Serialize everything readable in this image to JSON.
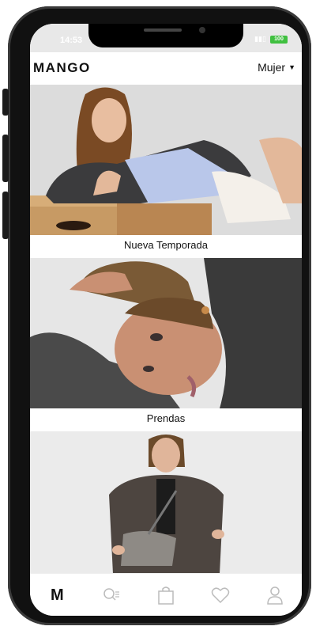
{
  "status_bar": {
    "time": "14:53",
    "signal": "ᵗᵐ⁺ˡ",
    "battery": "100"
  },
  "header": {
    "logo": "MANGO",
    "category": "Mujer"
  },
  "feed": {
    "cards": [
      {
        "label": "Nueva Temporada"
      },
      {
        "label": "Prendas"
      },
      {
        "label": ""
      }
    ]
  },
  "bottom_nav": {
    "items": [
      {
        "icon": "mango-home-icon",
        "glyph": "M"
      },
      {
        "icon": "search-icon"
      },
      {
        "icon": "shopping-bag-icon"
      },
      {
        "icon": "heart-icon"
      },
      {
        "icon": "user-icon"
      }
    ]
  }
}
